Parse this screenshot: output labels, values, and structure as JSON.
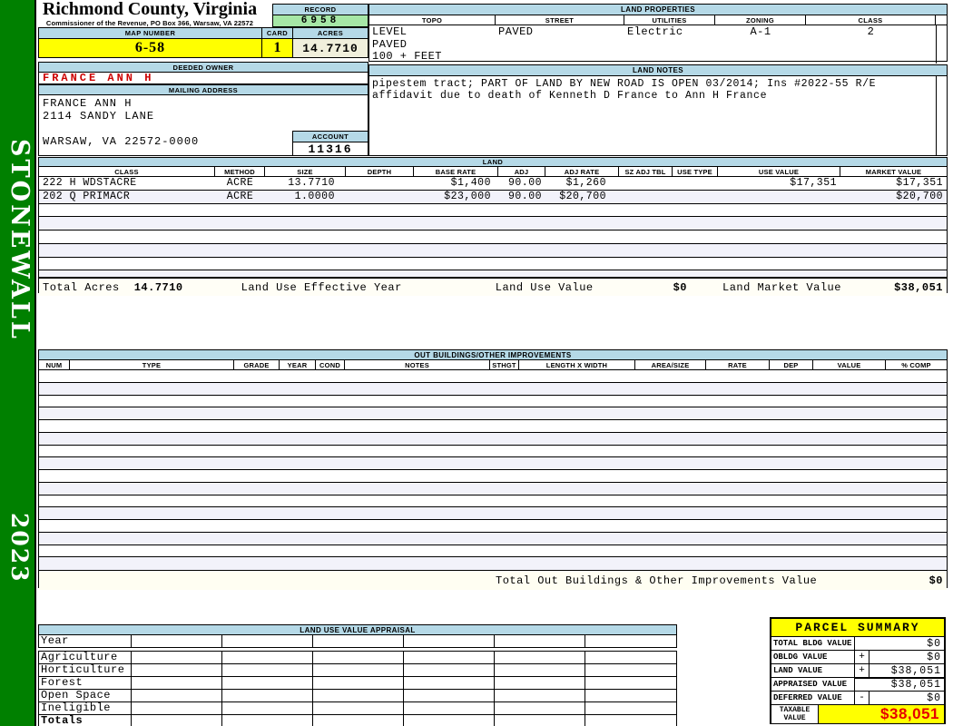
{
  "app": {
    "district": "STONEWALL",
    "year": "2023"
  },
  "header": {
    "county_title": "Richmond County, Virginia",
    "county_subtitle": "Commissioner of the Revenue, PO Box 366, Warsaw, VA 22572",
    "record_label": "RECORD",
    "record_value": "6958",
    "map_number_label": "MAP NUMBER",
    "map_number_value": "6-58",
    "card_label": "CARD",
    "card_value": "1",
    "acres_label": "ACRES",
    "acres_value": "14.7710"
  },
  "owner": {
    "deeded_owner_label": "DEEDED OWNER",
    "deeded_owner": "FRANCE ANN H",
    "mailing_address_label": "MAILING ADDRESS",
    "mailing_lines": [
      "FRANCE ANN H",
      "2114 SANDY LANE",
      "",
      "WARSAW, VA 22572-0000"
    ],
    "account_label": "ACCOUNT",
    "account_value": "11316"
  },
  "land_properties": {
    "title": "LAND PROPERTIES",
    "columns": [
      "TOPO",
      "STREET",
      "UTILITIES",
      "ZONING",
      "CLASS"
    ],
    "topo_lines": [
      "LEVEL",
      "PAVED",
      "100 + FEET"
    ],
    "street": "PAVED",
    "utilities": "Electric",
    "zoning": "A-1",
    "class": "2"
  },
  "land_notes": {
    "title": "LAND NOTES",
    "text": "pipestem tract; PART OF LAND BY NEW ROAD IS OPEN 03/2014; Ins #2022-55 R/E\naffidavit due to death of Kenneth D France to Ann H France"
  },
  "land_table": {
    "title": "LAND",
    "columns": [
      "CLASS",
      "METHOD",
      "SIZE",
      "DEPTH",
      "BASE RATE",
      "ADJ",
      "ADJ RATE",
      "SZ ADJ TBL",
      "USE TYPE",
      "USE VALUE",
      "MARKET VALUE"
    ],
    "rows": [
      {
        "class": "222 H WDSTACRE",
        "method": "ACRE",
        "size": "13.7710",
        "depth": "",
        "base_rate": "$1,400",
        "adj": "90.00",
        "adj_rate": "$1,260",
        "sz_adj_tbl": "",
        "use_type": "",
        "use_value": "$17,351",
        "market_value": "$17,351"
      },
      {
        "class": "202 Q PRIMACR",
        "method": "ACRE",
        "size": "1.0000",
        "depth": "",
        "base_rate": "$23,000",
        "adj": "90.00",
        "adj_rate": "$20,700",
        "sz_adj_tbl": "",
        "use_type": "",
        "use_value": "",
        "market_value": "$20,700"
      }
    ],
    "totals": {
      "total_acres_label": "Total Acres",
      "total_acres": "14.7710",
      "effective_year_label": "Land Use Effective Year",
      "use_value_label": "Land Use Value",
      "use_value": "$0",
      "market_value_label": "Land Market Value",
      "market_value": "$38,051"
    }
  },
  "out_buildings": {
    "title": "OUT BUILDINGS/OTHER IMPROVEMENTS",
    "columns": [
      "NUM",
      "TYPE",
      "GRADE",
      "YEAR",
      "COND",
      "NOTES",
      "STHGT",
      "LENGTH X WIDTH",
      "AREA/SIZE",
      "RATE",
      "DEP",
      "VALUE",
      "% COMP"
    ],
    "total_label": "Total Out Buildings & Other Improvements Value",
    "total_value": "$0"
  },
  "land_use_appraisal": {
    "title": "LAND USE VALUE APPRAISAL",
    "row_labels": [
      "Year",
      "Agriculture",
      "Horticulture",
      "Forest",
      "Open Space",
      "Ineligible",
      "Totals"
    ],
    "value_columns": 6
  },
  "parcel_summary": {
    "title": "PARCEL SUMMARY",
    "rows": [
      {
        "label": "TOTAL BLDG VALUE",
        "op": "",
        "value": "$0"
      },
      {
        "label": "OBLDG VALUE",
        "op": "+",
        "value": "$0"
      },
      {
        "label": "LAND VALUE",
        "op": "+",
        "value": "$38,051"
      },
      {
        "label": "APPRAISED VALUE",
        "op": "",
        "value": "$38,051"
      },
      {
        "label": "DEFERRED VALUE",
        "op": "-",
        "value": "$0"
      }
    ],
    "taxable_label_line1": "TAXABLE",
    "taxable_label_line2": "VALUE",
    "taxable_value": "$38,051"
  },
  "colors": {
    "sidebar_green": "#008000",
    "header_blue": "#b5d9e7",
    "highlight_yellow": "#ffff00",
    "record_green": "#a6e7a6",
    "acres_cream": "#f0efdc",
    "owner_red": "#cc0000",
    "taxable_red": "#e60000"
  }
}
